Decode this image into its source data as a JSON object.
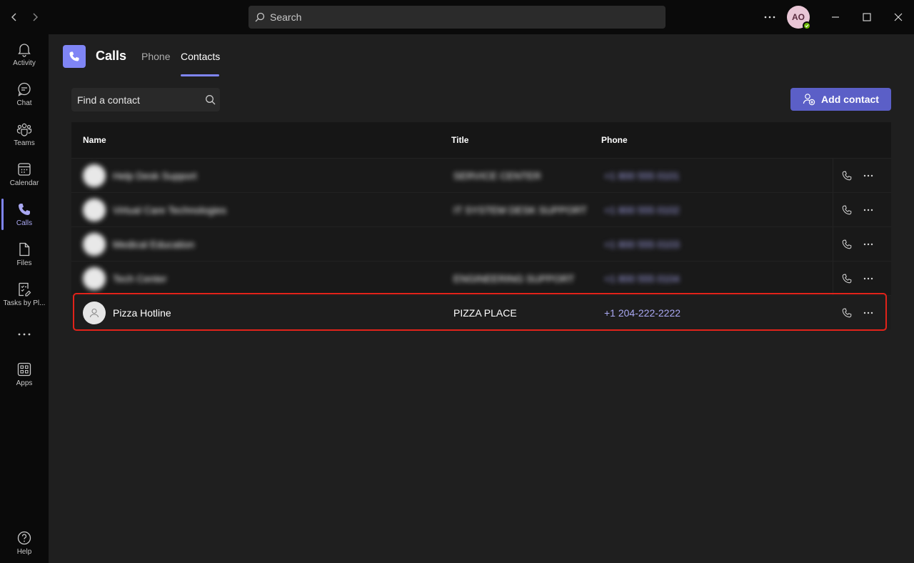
{
  "titlebar": {
    "search_placeholder": "Search",
    "avatar_initials": "AO",
    "icons": [
      "back-icon",
      "forward-icon",
      "search-icon",
      "more-icon",
      "minimize-icon",
      "maximize-icon",
      "close-icon"
    ]
  },
  "rail": {
    "items": [
      {
        "label": "Activity",
        "icon": "bell-icon"
      },
      {
        "label": "Chat",
        "icon": "chat-icon"
      },
      {
        "label": "Teams",
        "icon": "teams-icon"
      },
      {
        "label": "Calendar",
        "icon": "calendar-icon"
      },
      {
        "label": "Calls",
        "icon": "phone-icon",
        "active": true
      },
      {
        "label": "Files",
        "icon": "file-icon"
      },
      {
        "label": "Tasks by Pl...",
        "icon": "tasks-icon"
      },
      {
        "label": "Apps",
        "icon": "apps-icon"
      },
      {
        "label": "Help",
        "icon": "help-icon"
      }
    ]
  },
  "header": {
    "title": "Calls",
    "tabs": [
      {
        "label": "Phone"
      },
      {
        "label": "Contacts",
        "active": true
      }
    ]
  },
  "find_contact": {
    "placeholder": "Find a contact"
  },
  "add_contact": {
    "label": "Add contact"
  },
  "table": {
    "columns": [
      "Name",
      "Title",
      "Phone"
    ],
    "rows": [
      {
        "name": "Help Desk Support",
        "title": "SERVICE CENTER",
        "phone": "+1 800 555 0101",
        "blurred": true
      },
      {
        "name": "Virtual Care Technologies",
        "title": "IT SYSTEM DESK SUPPORT",
        "phone": "+1 800 555 0102",
        "blurred": true
      },
      {
        "name": "Medical Education",
        "title": "",
        "phone": "+1 800 555 0103",
        "blurred": true
      },
      {
        "name": "Tech Center",
        "title": "ENGINEERING SUPPORT",
        "phone": "+1 800 555 0104",
        "blurred": true
      },
      {
        "name": "Pizza Hotline",
        "title": "PIZZA PLACE",
        "phone": "+1 204-222-2222",
        "blurred": false
      }
    ]
  },
  "colors": {
    "accent": "#7f85f5",
    "button": "#5b5fc7",
    "highlight": "#e2231a",
    "phone_link": "#a9a8f2"
  }
}
